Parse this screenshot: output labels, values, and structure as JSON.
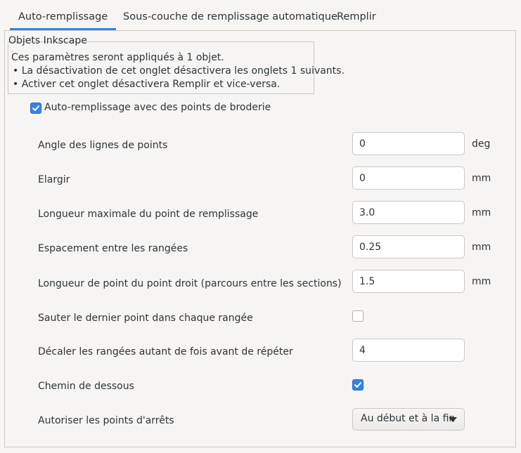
{
  "tabs": [
    {
      "label": "Auto-remplissage",
      "active": true
    },
    {
      "label": "Sous-couche de remplissage automatique",
      "active": false
    },
    {
      "label": "Remplir",
      "active": false
    }
  ],
  "info": {
    "title": "Objets Inkscape",
    "lines": [
      "Ces paramètres seront appliqués à 1 objet.",
      "• La désactivation de cet onglet désactivera les onglets 1 suivants.",
      "• Activer cet onglet désactivera Remplir et vice-versa."
    ]
  },
  "main_checkbox": {
    "label": "Auto-remplissage avec des points de broderie",
    "checked": true
  },
  "params": [
    {
      "label": "Angle des lignes de points",
      "value": "0",
      "unit": "deg"
    },
    {
      "label": "Elargir",
      "value": "0",
      "unit": "mm"
    },
    {
      "label": "Longueur maximale du point de remplissage",
      "value": "3.0",
      "unit": "mm"
    },
    {
      "label": "Espacement entre les rangées",
      "value": "0.25",
      "unit": "mm"
    },
    {
      "label": "Longueur de point du point droit (parcours entre les sections)",
      "value": "1.5",
      "unit": "mm"
    },
    {
      "label": "Sauter le dernier point dans chaque rangée",
      "checked": false
    },
    {
      "label": "Décaler les rangées autant de fois avant de répéter",
      "value": "4"
    },
    {
      "label": "Chemin de dessous",
      "checked": true
    },
    {
      "label": "Autoriser les points d'arrêts",
      "selected": "Au début et à la fin"
    }
  ],
  "colors": {
    "accent": "#3584e4",
    "background": "#f6f5f4",
    "border": "#cdc7c2",
    "text": "#2e3436"
  }
}
